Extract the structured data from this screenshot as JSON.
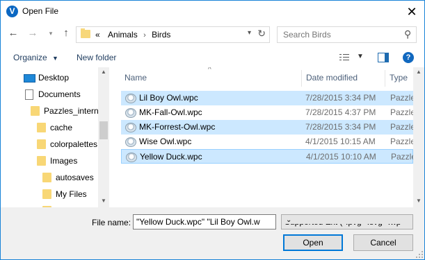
{
  "window": {
    "title": "Open File",
    "app_icon_letter": "V"
  },
  "navigation": {
    "breadcrumbs": [
      "Animals",
      "Birds"
    ],
    "overflow_marker": "«",
    "search_placeholder": "Search Birds"
  },
  "toolbar": {
    "organize_label": "Organize",
    "new_folder_label": "New folder"
  },
  "nav_pane": {
    "items": [
      {
        "label": "Desktop",
        "icon": "desktop-icon"
      },
      {
        "label": "Documents",
        "icon": "documents-icon"
      },
      {
        "label": "Pazzles_interna",
        "icon": "folder-icon"
      },
      {
        "label": "cache",
        "icon": "folder-icon"
      },
      {
        "label": "colorpalettes",
        "icon": "folder-icon"
      },
      {
        "label": "Images",
        "icon": "folder-icon"
      },
      {
        "label": "autosaves",
        "icon": "folder-icon"
      },
      {
        "label": "My Files",
        "icon": "folder-icon"
      }
    ]
  },
  "file_list": {
    "columns": [
      "Name",
      "Date modified",
      "Type"
    ],
    "rows": [
      {
        "name": "Lil Boy Owl.wpc",
        "date": "7/28/2015 3:34 PM",
        "type": "Pazzles Do",
        "selected": true
      },
      {
        "name": "MK-Fall-Owl.wpc",
        "date": "7/28/2015 4:37 PM",
        "type": "Pazzles Do",
        "selected": false
      },
      {
        "name": "MK-Forrest-Owl.wpc",
        "date": "7/28/2015 3:34 PM",
        "type": "Pazzles Do",
        "selected": true
      },
      {
        "name": "Wise Owl.wpc",
        "date": "4/1/2015 10:15 AM",
        "type": "Pazzles Do",
        "selected": false
      },
      {
        "name": "Yellow Duck.wpc",
        "date": "4/1/2015 10:10 AM",
        "type": "Pazzles Do",
        "selected": true
      }
    ]
  },
  "bottom": {
    "file_name_label": "File name:",
    "file_name_value": "\"Yellow Duck.wpc\" \"Lil Boy Owl.w",
    "filter_value": "Supported Ext (*.pvg *.svg *.wp",
    "open_label": "Open",
    "cancel_label": "Cancel"
  },
  "colors": {
    "accent": "#0078d7",
    "selection": "#cce8ff",
    "border": "#1883d7"
  }
}
